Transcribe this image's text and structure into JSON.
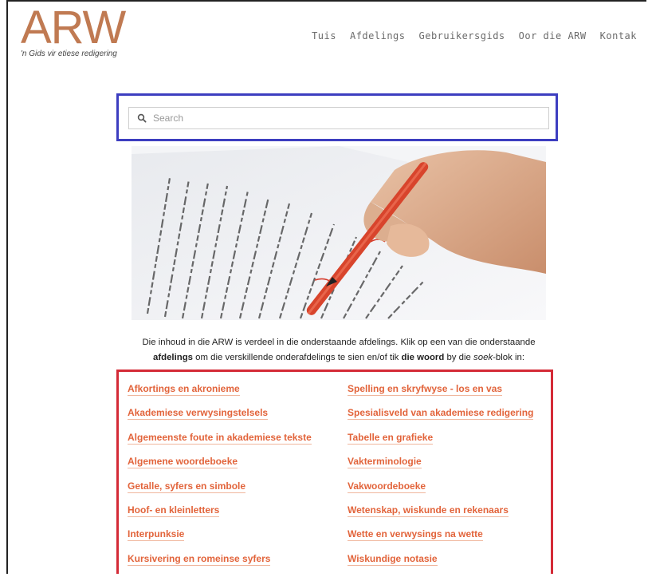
{
  "header": {
    "logo_text": "ARW",
    "tagline": "'n Gids vir etiese redigering",
    "nav": [
      "Tuis",
      "Afdelings",
      "Gebruikersgids",
      "Oor die ARW",
      "Kontak"
    ]
  },
  "search": {
    "placeholder": "Search",
    "value": ""
  },
  "intro": {
    "line1": "Die inhoud in die ARW is verdeel in die onderstaande afdelings. Klik op een van die onderstaande",
    "line2_bold1": "afdelings",
    "line2_text1": " om die verskillende onderafdelings te sien en/of tik ",
    "line2_bold2": "die woord",
    "line2_text2": " by die ",
    "line2_italic": "soek",
    "line2_text3": "-blok in:"
  },
  "sections_left": [
    "Afkortings en akronieme",
    "Akademiese verwysingstelsels",
    "Algemeenste foute in akademiese tekste",
    "Algemene woordeboeke",
    "Getalle, syfers en simbole",
    "Hoof- en kleinletters",
    "Interpunksie",
    "Kursivering en romeinse syfers"
  ],
  "sections_right": [
    "Spelling en skryfwyse - los en vas",
    "Spesialisveld van akademiese redigering",
    "Tabelle en grafieke",
    "Vakterminologie",
    "Vakwoordeboeke",
    "Wetenskap, wiskunde en rekenaars",
    "Wette en verwysings na wette",
    "Wiskundige notasie"
  ],
  "colors": {
    "logo": "#c07a52",
    "link": "#e2643b",
    "search_highlight": "#3d3ec0",
    "links_highlight": "#d42b37"
  }
}
